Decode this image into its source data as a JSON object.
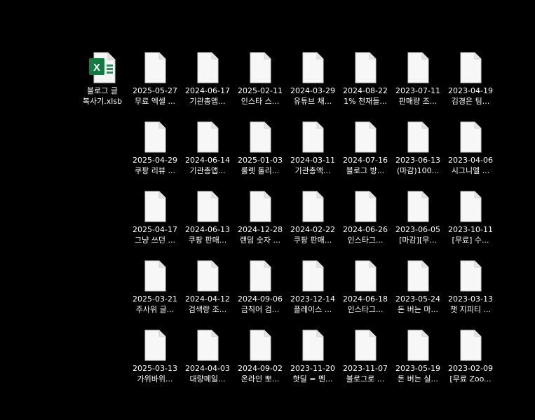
{
  "desktop": {
    "featured_file": {
      "name_line1": "블로그 글",
      "name_line2": "복사기.xlsb",
      "icon": "excel-icon",
      "icon_letter": "X",
      "brand_color": "#107C41"
    },
    "files": [
      {
        "date": "2025-05-27",
        "title": "무료 엑셀 ..."
      },
      {
        "date": "2024-06-17",
        "title": "기관총앱..."
      },
      {
        "date": "2025-02-11",
        "title": "인스타 스..."
      },
      {
        "date": "2024-03-29",
        "title": "유튜브 채..."
      },
      {
        "date": "2024-08-22",
        "title": "1% 천재들..."
      },
      {
        "date": "2023-07-11",
        "title": "판매량 조..."
      },
      {
        "date": "2023-04-19",
        "title": "김경은 팀..."
      },
      {
        "date": "2025-04-29",
        "title": "쿠팡 리뷰 ..."
      },
      {
        "date": "2024-06-14",
        "title": "기관총앱..."
      },
      {
        "date": "2025-01-03",
        "title": "룰렛 돌리..."
      },
      {
        "date": "2024-03-11",
        "title": "기관총액..."
      },
      {
        "date": "2024-07-16",
        "title": "블로그 방..."
      },
      {
        "date": "2023-06-13",
        "title": "(마감)100..."
      },
      {
        "date": "2023-04-06",
        "title": "시그니엘 ..."
      },
      {
        "date": "2025-04-17",
        "title": "그냥 쓰던 ..."
      },
      {
        "date": "2024-06-13",
        "title": "쿠팡 판매..."
      },
      {
        "date": "2024-12-28",
        "title": "랜덤 숫자 ..."
      },
      {
        "date": "2024-02-22",
        "title": "쿠팡 판매..."
      },
      {
        "date": "2024-06-26",
        "title": "인스타그..."
      },
      {
        "date": "2023-06-05",
        "title": "[마감][무..."
      },
      {
        "date": "2023-10-11",
        "title": "[무료] 수..."
      },
      {
        "date": "2025-03-21",
        "title": "주사위 글..."
      },
      {
        "date": "2024-04-12",
        "title": "검색량 조..."
      },
      {
        "date": "2024-09-06",
        "title": "금칙어 검..."
      },
      {
        "date": "2023-12-14",
        "title": "플레이스 ..."
      },
      {
        "date": "2024-06-18",
        "title": "인스타그..."
      },
      {
        "date": "2023-05-24",
        "title": "돈 버는 마..."
      },
      {
        "date": "2023-03-13",
        "title": "챗 지피티 ..."
      },
      {
        "date": "2025-03-13",
        "title": "가위바위..."
      },
      {
        "date": "2024-04-03",
        "title": "대량메일..."
      },
      {
        "date": "2024-09-02",
        "title": "온라인 뽀..."
      },
      {
        "date": "2023-11-20",
        "title": "핫딜 = 멘..."
      },
      {
        "date": "2023-11-07",
        "title": "블로그로 ..."
      },
      {
        "date": "2023-05-19",
        "title": "돈 버는 실..."
      },
      {
        "date": "2023-02-09",
        "title": "[무료 Zoo..."
      }
    ],
    "file_icon": "blank-document-icon"
  }
}
